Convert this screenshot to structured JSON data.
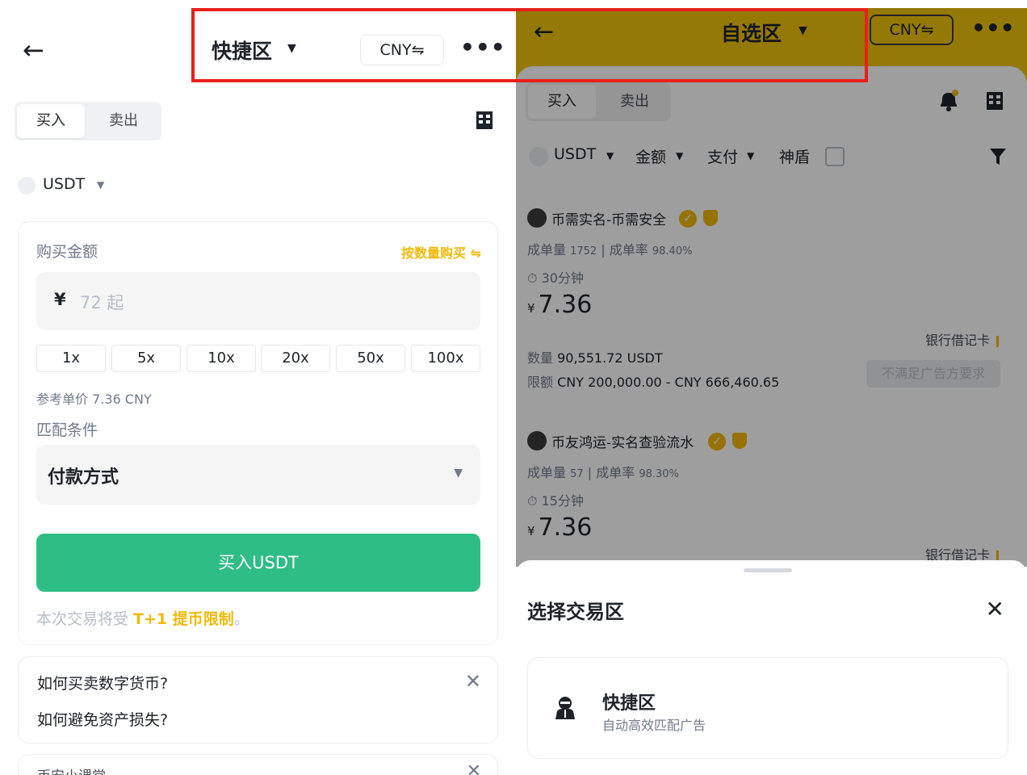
{
  "left": {
    "header": {
      "back_icon": "arrow-left-icon",
      "title": "快捷区",
      "currency": "CNY⇋",
      "more_icon": "more-dots-icon"
    },
    "tabs": {
      "buy": "买入",
      "sell": "卖出"
    },
    "asset": {
      "name": "USDT"
    },
    "form": {
      "amount_label": "购买金额",
      "switch_label": "按数量购买 ⇋",
      "currency_symbol": "¥",
      "amount_placeholder": "72 起",
      "multipliers": [
        "1x",
        "5x",
        "10x",
        "20x",
        "50x",
        "100x"
      ],
      "ref_price": "参考单价 7.36 CNY",
      "match_label": "匹配条件",
      "payment_select": "付款方式",
      "buy_button": "买入USDT",
      "notice_prefix": "本次交易将受 ",
      "notice_highlight": "T+1 提币限制",
      "notice_suffix": "。"
    },
    "faq": {
      "q1": "如何买卖数字货币?",
      "q2": "如何避免资产损失?",
      "next_title": "币安小课堂"
    }
  },
  "right": {
    "header": {
      "title": "自选区",
      "currency": "CNY⇋"
    },
    "tabs": {
      "buy": "买入",
      "sell": "卖出"
    },
    "filters": {
      "asset": "USDT",
      "amount": "金额",
      "payment": "支付",
      "shield": "神盾"
    },
    "ads": [
      {
        "name": "币需实名-币需安全",
        "orders_label": "成单量",
        "orders": "1752",
        "rate_label": "成单率",
        "rate": "98.40%",
        "time": "30分钟",
        "currency": "¥",
        "price": "7.36",
        "payment": "银行借记卡",
        "qty_label": "数量",
        "qty": "90,551.72 USDT",
        "limit_label": "限额",
        "limit": "CNY 200,000.00 - CNY 666,460.65",
        "button": "不满足广告方要求"
      },
      {
        "name": "币友鸿运-实名查验流水",
        "orders_label": "成单量",
        "orders": "57",
        "rate_label": "成单率",
        "rate": "98.30%",
        "time": "15分钟",
        "currency": "¥",
        "price": "7.36",
        "payment": "银行借记卡"
      }
    ],
    "sheet": {
      "title": "选择交易区",
      "option_title": "快捷区",
      "option_sub": "自动高效匹配广告"
    }
  },
  "colors": {
    "brand_yellow": "#f0b90b",
    "buy_green": "#2ebd85",
    "highlight_red": "#e8201a"
  }
}
